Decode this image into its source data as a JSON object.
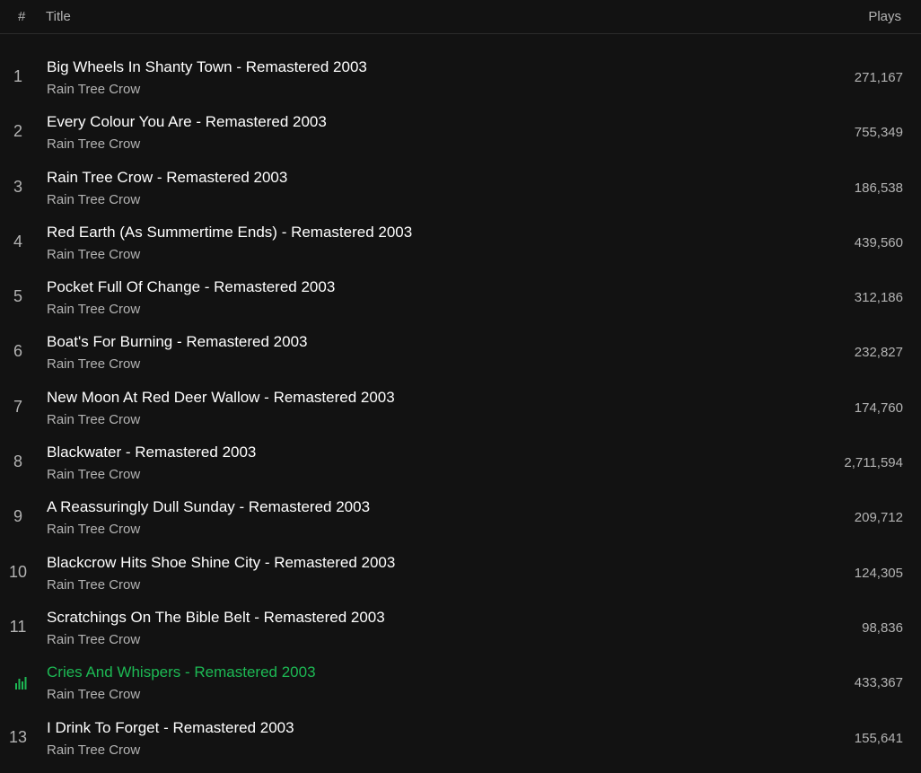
{
  "header": {
    "num_label": "#",
    "title_label": "Title",
    "plays_label": "Plays"
  },
  "tracks": [
    {
      "num": "1",
      "title": "Big Wheels In Shanty Town - Remastered 2003",
      "artist": "Rain Tree Crow",
      "plays": "271,167"
    },
    {
      "num": "2",
      "title": "Every Colour You Are - Remastered 2003",
      "artist": "Rain Tree Crow",
      "plays": "755,349"
    },
    {
      "num": "3",
      "title": "Rain Tree Crow - Remastered 2003",
      "artist": "Rain Tree Crow",
      "plays": "186,538"
    },
    {
      "num": "4",
      "title": "Red Earth (As Summertime Ends) - Remastered 2003",
      "artist": "Rain Tree Crow",
      "plays": "439,560"
    },
    {
      "num": "5",
      "title": "Pocket Full Of Change - Remastered 2003",
      "artist": "Rain Tree Crow",
      "plays": "312,186"
    },
    {
      "num": "6",
      "title": "Boat's For Burning - Remastered 2003",
      "artist": "Rain Tree Crow",
      "plays": "232,827"
    },
    {
      "num": "7",
      "title": "New Moon At Red Deer Wallow - Remastered 2003",
      "artist": "Rain Tree Crow",
      "plays": "174,760"
    },
    {
      "num": "8",
      "title": "Blackwater - Remastered 2003",
      "artist": "Rain Tree Crow",
      "plays": "2,711,594"
    },
    {
      "num": "9",
      "title": "A Reassuringly Dull Sunday - Remastered 2003",
      "artist": "Rain Tree Crow",
      "plays": "209,712"
    },
    {
      "num": "10",
      "title": "Blackcrow Hits Shoe Shine City - Remastered 2003",
      "artist": "Rain Tree Crow",
      "plays": "124,305"
    },
    {
      "num": "11",
      "title": "Scratchings On The Bible Belt - Remastered 2003",
      "artist": "Rain Tree Crow",
      "plays": "98,836"
    },
    {
      "num": "",
      "title": "Cries And Whispers - Remastered 2003",
      "artist": "Rain Tree Crow",
      "plays": "433,367",
      "playing": true
    },
    {
      "num": "13",
      "title": "I Drink To Forget - Remastered 2003",
      "artist": "Rain Tree Crow",
      "plays": "155,641"
    }
  ],
  "colors": {
    "background": "#121212",
    "accent": "#1db954",
    "secondary_text": "#b3b3b3"
  },
  "icons": {
    "now_playing": "equalizer-bars-icon"
  }
}
